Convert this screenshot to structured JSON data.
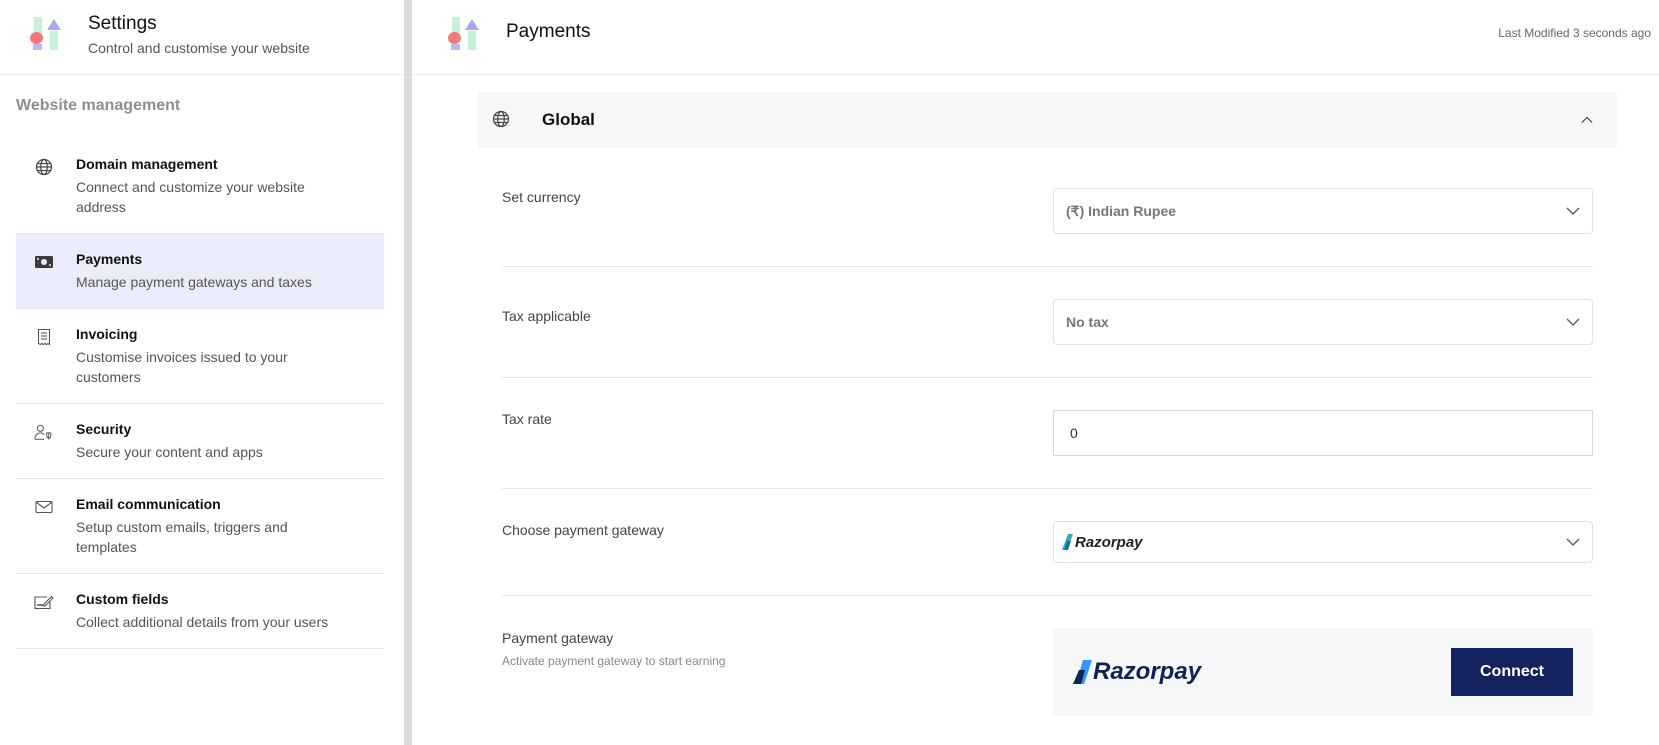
{
  "sidebar": {
    "title": "Settings",
    "subtitle": "Control and customise your website",
    "section_label": "Website management",
    "items": [
      {
        "icon": "globe-icon",
        "title": "Domain management",
        "desc": "Connect and customize your website address",
        "active": false
      },
      {
        "icon": "money-icon",
        "title": "Payments",
        "desc": "Manage payment gateways and taxes",
        "active": true
      },
      {
        "icon": "receipt-icon",
        "title": "Invoicing",
        "desc": "Customise invoices issued to your customers",
        "active": false
      },
      {
        "icon": "user-shield-icon",
        "title": "Security",
        "desc": "Secure your content and apps",
        "active": false
      },
      {
        "icon": "envelope-icon",
        "title": "Email communication",
        "desc": "Setup custom emails, triggers and templates",
        "active": false
      },
      {
        "icon": "edit-field-icon",
        "title": "Custom fields",
        "desc": "Collect additional details from your users",
        "active": false
      }
    ]
  },
  "main": {
    "title": "Payments",
    "last_modified": "Last Modified 3 seconds ago",
    "section": {
      "title": "Global",
      "expanded": true,
      "rows": {
        "currency": {
          "label": "Set currency",
          "value": "(₹) Indian Rupee"
        },
        "tax": {
          "label": "Tax applicable",
          "value": "No tax"
        },
        "tax_rate": {
          "label": "Tax rate",
          "value": "0"
        },
        "gateway_select": {
          "label": "Choose payment gateway",
          "value": "Razorpay"
        },
        "gateway": {
          "label": "Payment gateway",
          "sublabel": "Activate payment gateway to start earning",
          "logo_text": "Razorpay",
          "button": "Connect"
        }
      }
    }
  },
  "colors": {
    "active_nav_bg": "#ebecfa",
    "connect_button": "#14235f",
    "razorpay_blue": "#3395ff",
    "razorpay_dark": "#0c2451"
  }
}
